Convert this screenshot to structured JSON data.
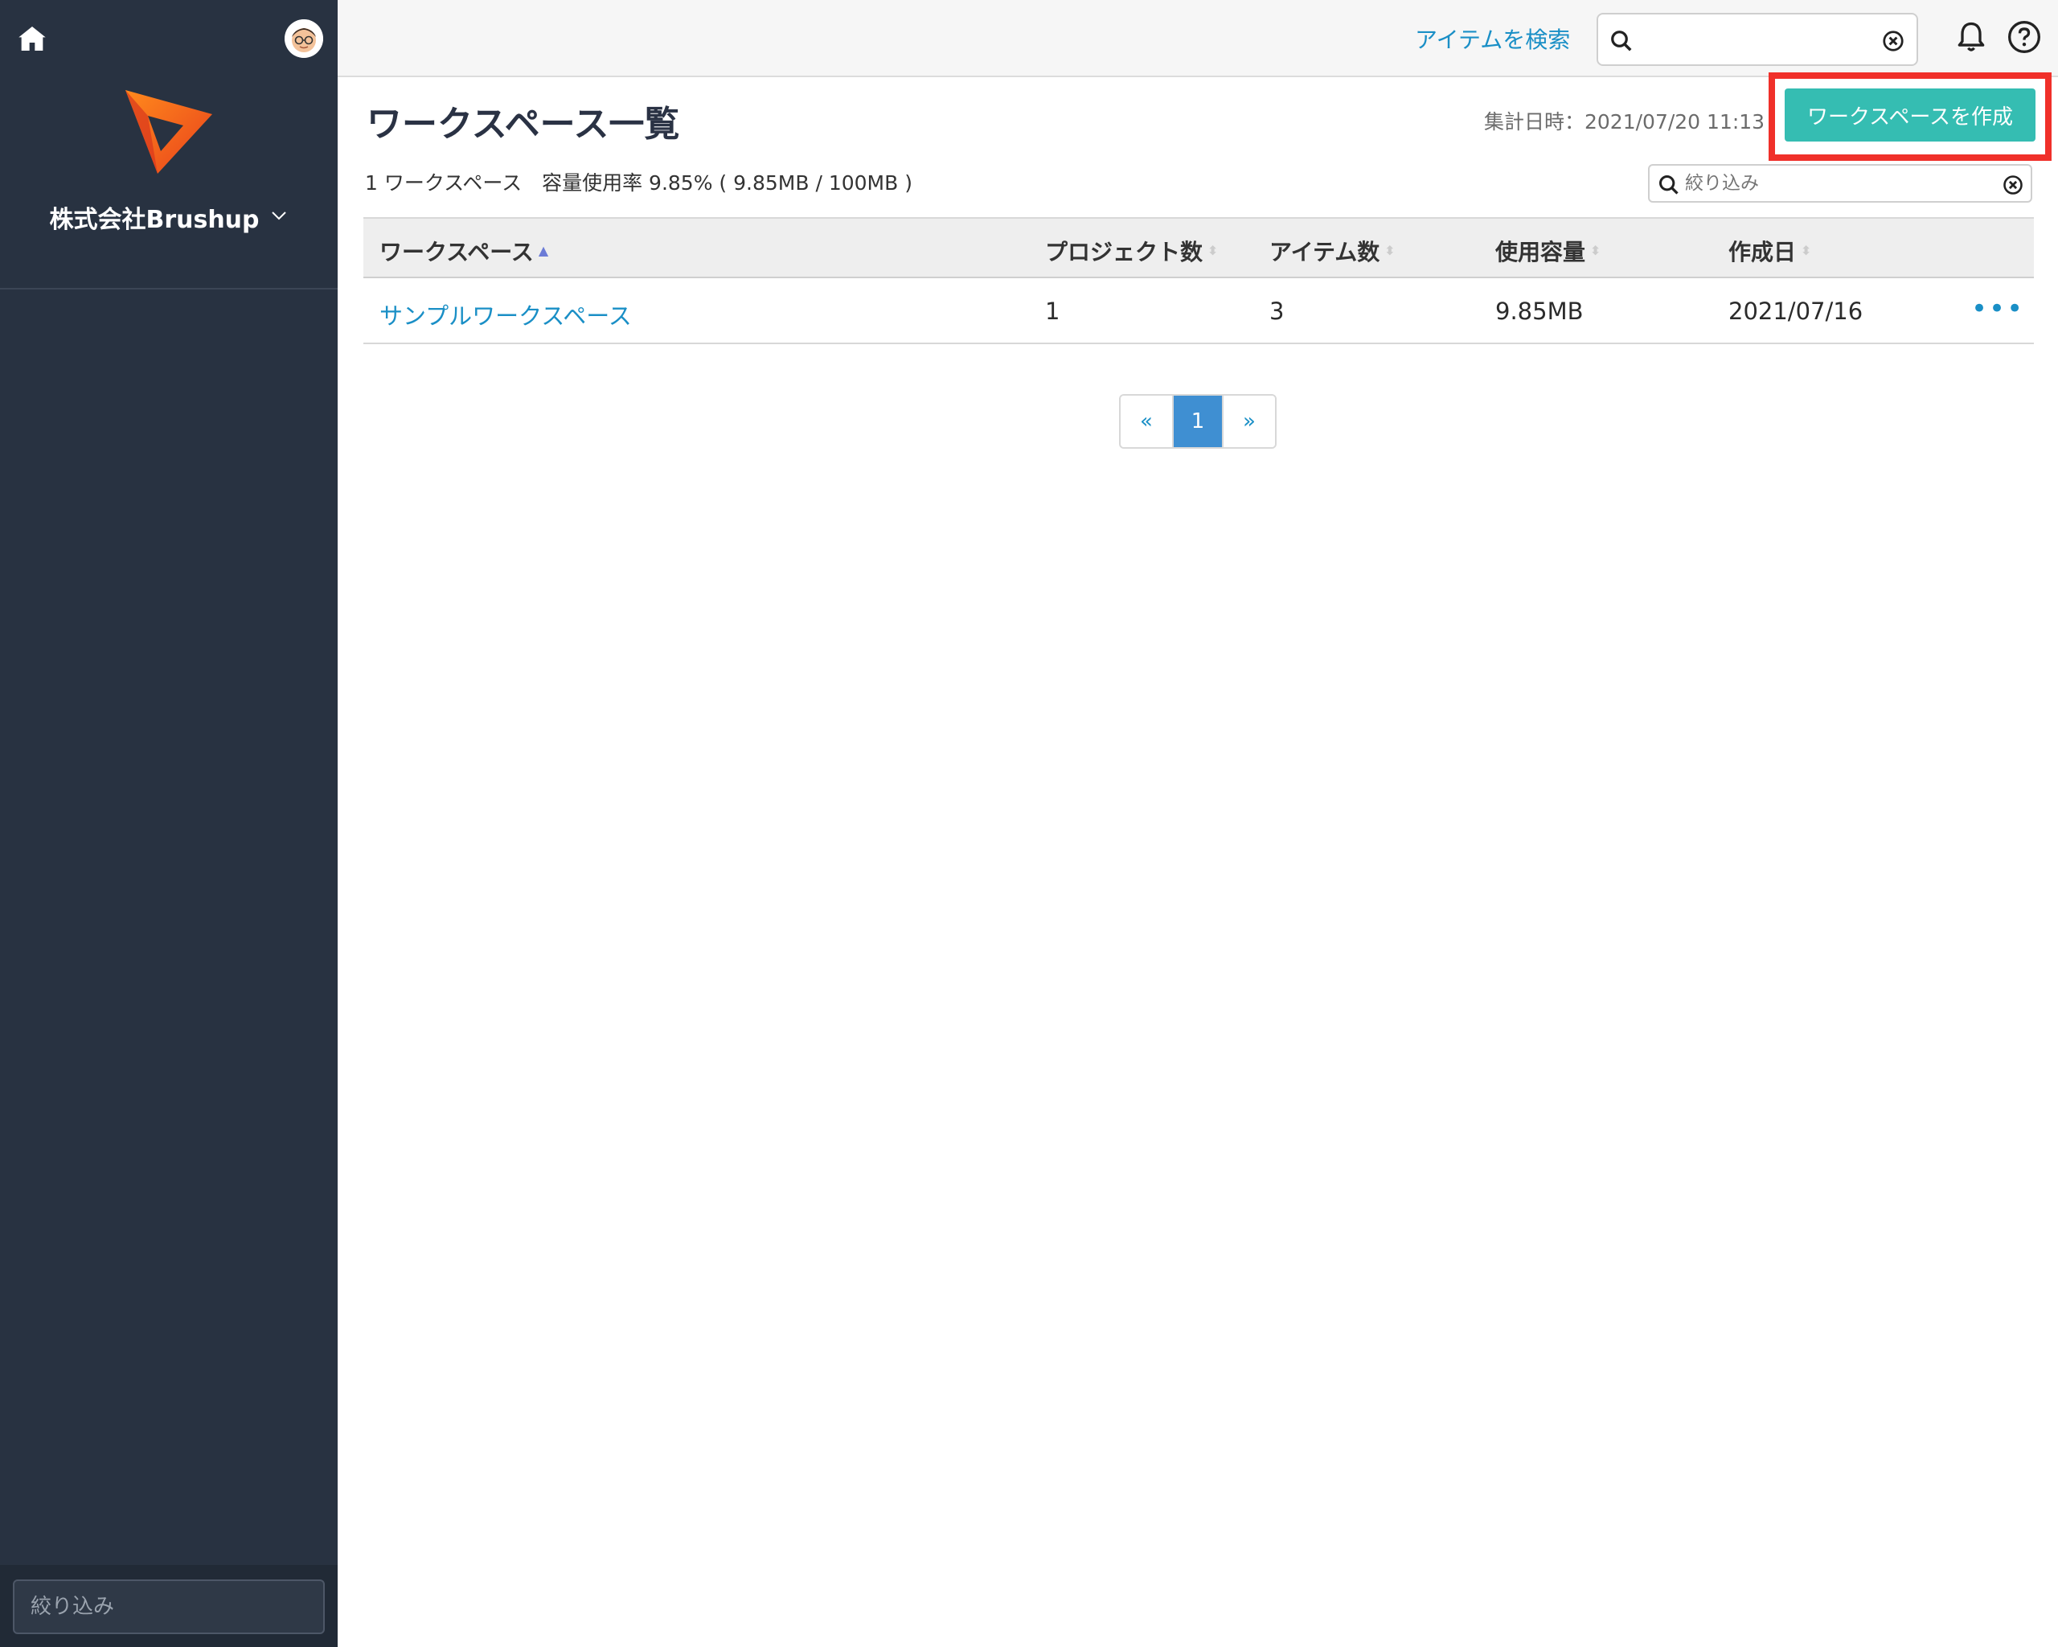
{
  "sidebar": {
    "org_name": "株式会社Brushup",
    "filter_placeholder": "絞り込み"
  },
  "header": {
    "search_link": "アイテムを検索",
    "search_value": ""
  },
  "main": {
    "title": "ワークスペース一覧",
    "aggregate": "集計日時：2021/07/20 11:13",
    "create_button": "ワークスペースを作成",
    "summary": "1 ワークスペース　容量使用率 9.85% ( 9.85MB / 100MB )",
    "filter_placeholder": "絞り込み"
  },
  "table": {
    "columns": [
      "ワークスペース",
      "プロジェクト数",
      "アイテム数",
      "使用容量",
      "作成日"
    ],
    "rows": [
      [
        "サンプルワークスペース",
        "1",
        "3",
        "9.85MB",
        "2021/07/16"
      ]
    ]
  },
  "pagination": {
    "prev": "«",
    "current": "1",
    "next": "»"
  },
  "colors": {
    "sidebar_bg": "#283241",
    "accent_teal": "#35bdb2",
    "link_blue": "#1a8fc6",
    "highlight_red": "#f0302a",
    "page_blue": "#3f8fd2"
  },
  "icons": [
    "home-icon",
    "avatar",
    "brushup-logo",
    "chevron-down-icon",
    "search-icon",
    "clear-icon",
    "bell-icon",
    "help-icon",
    "more-icon"
  ]
}
